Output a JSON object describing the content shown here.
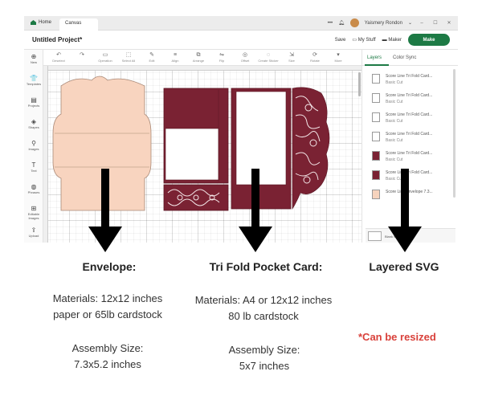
{
  "app": {
    "titlebar": {
      "home_label": "Home",
      "canvas_tab": "Canvas",
      "more": "•••",
      "user_name": "Yaismery Rondon",
      "minimize": "–",
      "maximize": "☐",
      "close": "✕"
    },
    "header": {
      "project_title": "Untitled Project*",
      "save": "Save",
      "my_stuff": "My Stuff",
      "maker": "Maker",
      "make": "Make"
    },
    "toolbar": {
      "tools": [
        {
          "label": "Deselect",
          "icon": "undo-icon",
          "glyph": "↶"
        },
        {
          "label": "",
          "icon": "redo-icon",
          "glyph": "↷"
        },
        {
          "label": "Operation",
          "icon": "operation-icon",
          "glyph": "▭"
        },
        {
          "label": "Select All",
          "icon": "select-all-icon",
          "glyph": "⬚"
        },
        {
          "label": "Edit",
          "icon": "edit-icon",
          "glyph": "✎"
        },
        {
          "label": "Align",
          "icon": "align-icon",
          "glyph": "≡"
        },
        {
          "label": "Arrange",
          "icon": "arrange-icon",
          "glyph": "⧉"
        },
        {
          "label": "Flip",
          "icon": "flip-icon",
          "glyph": "⇋"
        },
        {
          "label": "Offset",
          "icon": "offset-icon",
          "glyph": "◎"
        },
        {
          "label": "Create Sticker",
          "icon": "sticker-icon",
          "glyph": "◌"
        },
        {
          "label": "Size",
          "icon": "size-icon",
          "glyph": "⇲"
        },
        {
          "label": "Rotate",
          "icon": "rotate-icon",
          "glyph": "⟳"
        },
        {
          "label": "More",
          "icon": "more-icon",
          "glyph": "▾"
        }
      ]
    },
    "sidebar": {
      "items": [
        {
          "label": "New",
          "icon": "plus-icon",
          "glyph": "⊕"
        },
        {
          "label": "Templates",
          "icon": "templates-icon",
          "glyph": "👕"
        },
        {
          "label": "Projects",
          "icon": "projects-icon",
          "glyph": "▤"
        },
        {
          "label": "Shapes",
          "icon": "shapes-icon",
          "glyph": "◈"
        },
        {
          "label": "Images",
          "icon": "images-icon",
          "glyph": "⚲"
        },
        {
          "label": "Text",
          "icon": "text-icon",
          "glyph": "T"
        },
        {
          "label": "Phrases",
          "icon": "phrases-icon",
          "glyph": "◍"
        },
        {
          "label": "Editable Images",
          "icon": "editable-images-icon",
          "glyph": "⊞"
        },
        {
          "label": "Upload",
          "icon": "upload-icon",
          "glyph": "⇪"
        }
      ]
    },
    "layers_panel": {
      "tabs": [
        "Layers",
        "Color Sync"
      ],
      "layers": [
        {
          "name": "Score Line Tri Fold Card...",
          "type": "Basic Cut",
          "color": "#ffffff"
        },
        {
          "name": "Score Line Tri Fold Card...",
          "type": "Basic Cut",
          "color": "#ffffff"
        },
        {
          "name": "Score Line Tri Fold Card...",
          "type": "Basic Cut",
          "color": "#ffffff"
        },
        {
          "name": "Score Line Tri Fold Card...",
          "type": "Basic Cut",
          "color": "#ffffff"
        },
        {
          "name": "Score Line Tri Fold Card...",
          "type": "Basic Cut",
          "color": "#7a2233"
        },
        {
          "name": "Score Line Tri Fold Card...",
          "type": "Basic Cut",
          "color": "#7a2233"
        },
        {
          "name": "Score Line Envelope 7.3...",
          "type": "",
          "color": "#f6d3bd"
        }
      ],
      "blank_canvas": "Blank Canvas"
    },
    "colors": {
      "envelope": "#f8d4bf",
      "card": "#7a2233",
      "accent": "#1d7a45"
    }
  },
  "annotations": {
    "envelope": {
      "title": "Envelope:",
      "materials": [
        "Materials: 12x12 inches",
        "paper or 65lb cardstock"
      ],
      "assembly": [
        "Assembly Size:",
        "7.3x5.2 inches"
      ]
    },
    "tri_fold": {
      "title": "Tri Fold Pocket Card:",
      "materials": [
        "Materials: A4 or 12x12 inches",
        "80 lb cardstock"
      ],
      "assembly": [
        "Assembly Size:",
        "5x7 inches"
      ]
    },
    "layered": {
      "title": "Layered SVG",
      "note": "*Can be resized"
    }
  }
}
